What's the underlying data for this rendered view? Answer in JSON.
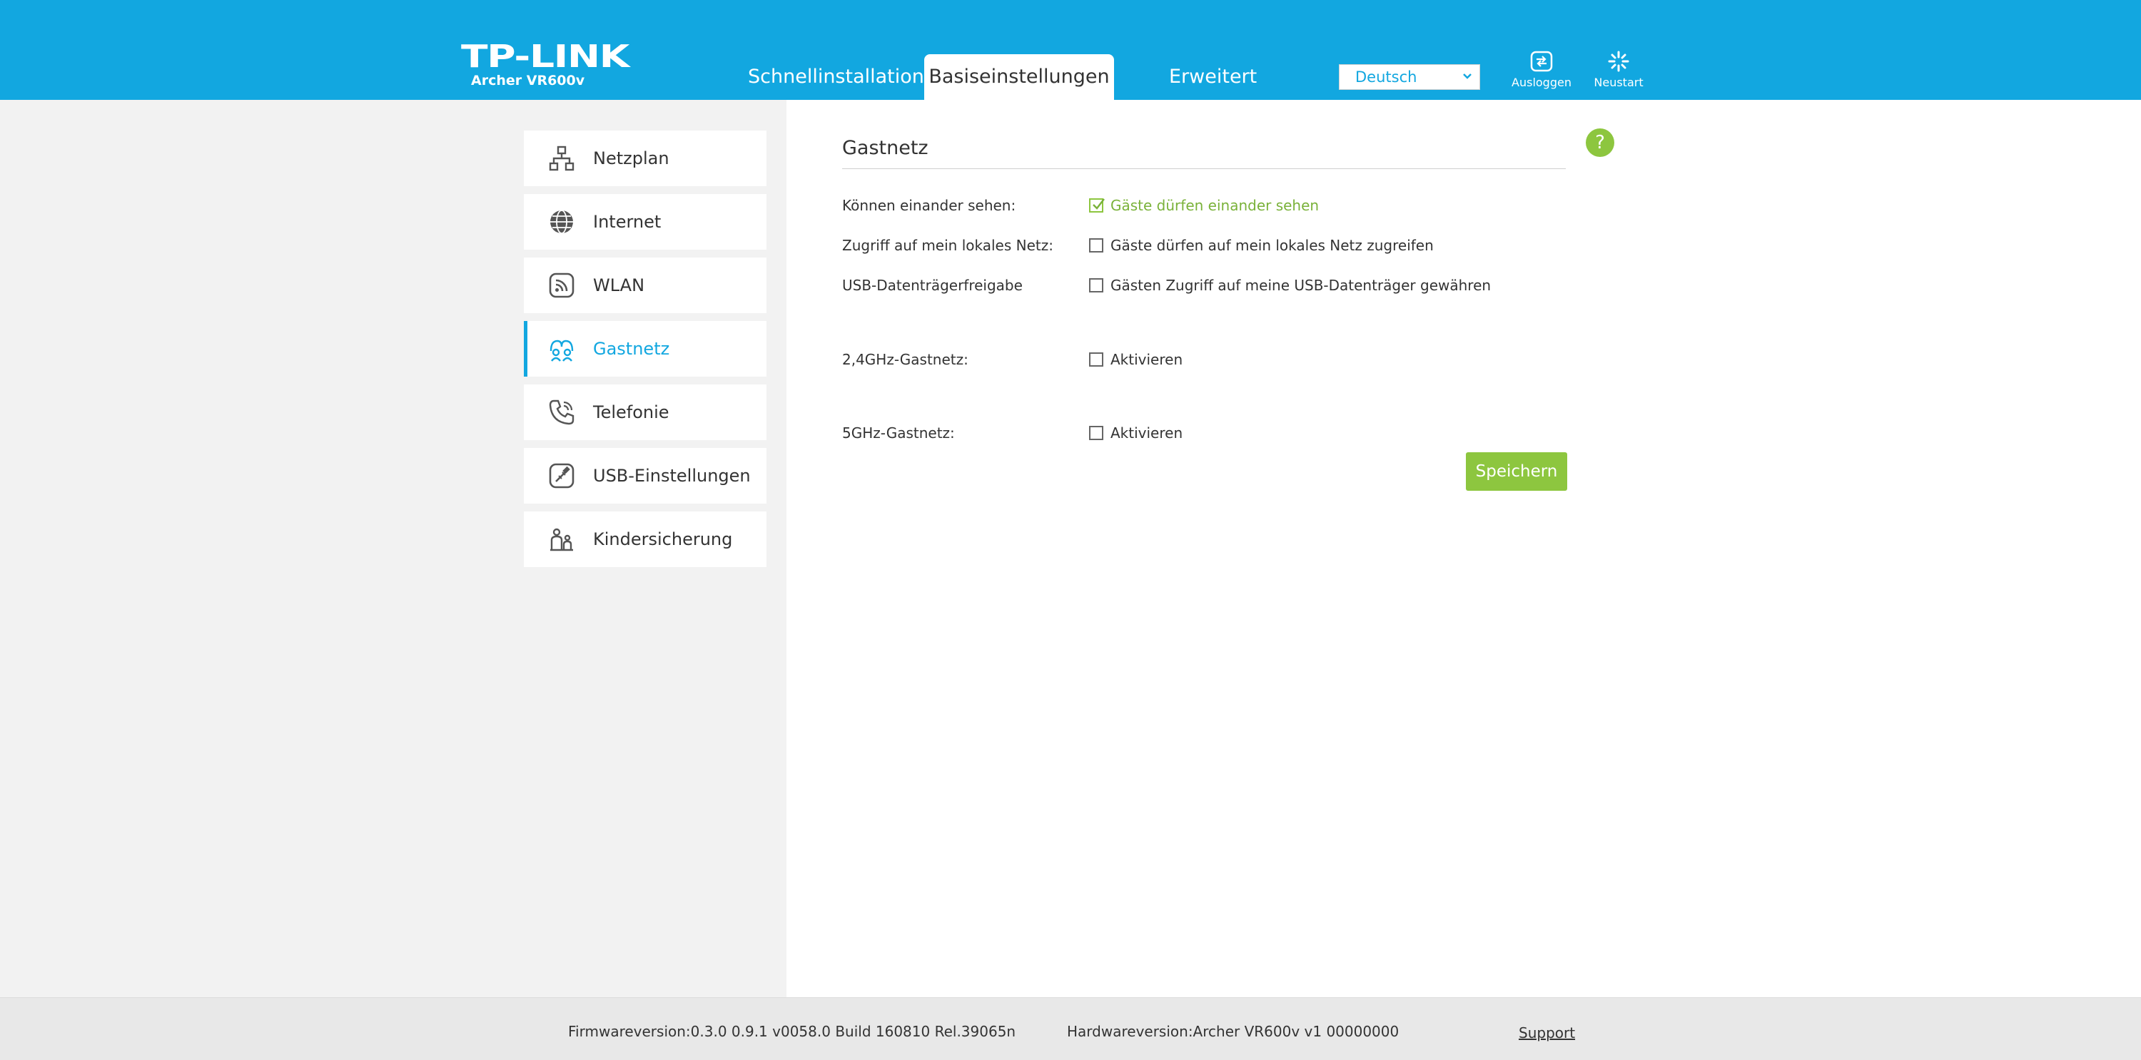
{
  "header": {
    "brand": "TP-LINK",
    "model": "Archer VR600v",
    "tabs": [
      {
        "label": "Schnellinstallation"
      },
      {
        "label": "Basiseinstellungen"
      },
      {
        "label": "Erweitert"
      }
    ],
    "active_tab": "Basiseinstellungen",
    "language": "Deutsch",
    "logout_label": "Ausloggen",
    "reboot_label": "Neustart"
  },
  "sidebar": {
    "items": [
      {
        "label": "Netzplan",
        "icon": "network-map-icon"
      },
      {
        "label": "Internet",
        "icon": "globe-icon"
      },
      {
        "label": "WLAN",
        "icon": "wifi-icon"
      },
      {
        "label": "Gastnetz",
        "icon": "guest-network-icon"
      },
      {
        "label": "Telefonie",
        "icon": "phone-icon"
      },
      {
        "label": "USB-Einstellungen",
        "icon": "usb-icon"
      },
      {
        "label": "Kindersicherung",
        "icon": "parental-control-icon"
      }
    ],
    "active": "Gastnetz"
  },
  "main": {
    "title": "Gastnetz",
    "rows": [
      {
        "label": "Können einander sehen:",
        "option": "Gäste dürfen einander sehen",
        "checked": true
      },
      {
        "label": "Zugriff auf mein lokales Netz:",
        "option": "Gäste dürfen auf mein lokales Netz zugreifen",
        "checked": false
      },
      {
        "label": "USB-Datenträgerfreigabe",
        "option": "Gästen Zugriff auf meine USB-Datenträger gewähren",
        "checked": false
      },
      {
        "label": "2,4GHz-Gastnetz:",
        "option": "Aktivieren",
        "checked": false
      },
      {
        "label": "5GHz-Gastnetz:",
        "option": "Aktivieren",
        "checked": false
      }
    ],
    "save_label": "Speichern",
    "help_label": "?"
  },
  "footer": {
    "firmware": "Firmwareversion:0.3.0 0.9.1 v0058.0 Build 160810 Rel.39065n",
    "hardware": "Hardwareversion:Archer VR600v v1 00000000",
    "support": "Support"
  },
  "colors": {
    "header_bg": "#12a7e0",
    "accent_green": "#8dc63f",
    "sidebar_bg": "#f2f2f2"
  }
}
